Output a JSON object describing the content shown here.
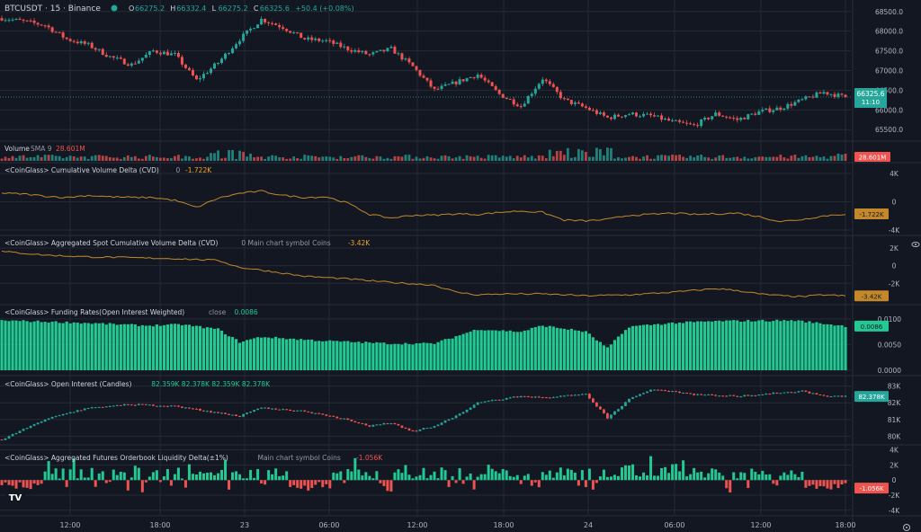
{
  "colors": {
    "bg": "#131722",
    "up": "#26a69a",
    "up_bright": "#22c993",
    "down": "#ef5350",
    "cvd": "#c4882b",
    "grid": "#262a35",
    "axis_text": "#b2b5be",
    "muted": "#9598a1"
  },
  "header": {
    "symbol": "BTCUSDT · 15 · Binance",
    "ohlc": [
      {
        "k": "O",
        "v": "66275.2"
      },
      {
        "k": "H",
        "v": "66332.4"
      },
      {
        "k": "L",
        "v": "66275.2"
      },
      {
        "k": "C",
        "v": "66325.6"
      }
    ],
    "change": "+50.4 (+0.08%)"
  },
  "price_badge": {
    "price": "66325.6",
    "countdown": "11:10"
  },
  "price_axis": [
    "68500.0",
    "68000.0",
    "67500.0",
    "67000.0",
    "66500.0",
    "66000.0",
    "65500.0"
  ],
  "panels": [
    {
      "id": "volume",
      "title": "Volume",
      "params": "SMA 9",
      "value": "28.601M",
      "badge": "28.601M",
      "axis": []
    },
    {
      "id": "cvd",
      "title": "<CoinGlass> Cumulative Volume Delta (CVD)",
      "params": "0",
      "value": "-1.722K",
      "badge": "-1.722K",
      "axis": [
        "4K",
        "0",
        "-4K"
      ]
    },
    {
      "id": "spot_cvd",
      "title": "<CoinGlass> Aggregated Spot Cumulative Volume Delta (CVD)",
      "params": "0 Main chart symbol Coins",
      "value": "-3.42K",
      "badge": "-3.42K",
      "axis": [
        "2K",
        "0",
        "-2K"
      ]
    },
    {
      "id": "funding",
      "title": "<CoinGlass> Funding Rates(Open Interest Weighted)",
      "params": "close",
      "value": "0.0086",
      "badge": "0.0086",
      "axis": [
        "0.0100",
        "0.0050",
        "0.0000"
      ]
    },
    {
      "id": "oi",
      "title": "<CoinGlass> Open Interest (Candles)",
      "params": "",
      "value": "82.359K 82.378K 82.359K 82.378K",
      "badge": "82.378K",
      "axis": [
        "83K",
        "82K",
        "81K",
        "80K"
      ]
    },
    {
      "id": "liq",
      "title": "<CoinGlass> Aggregated Futures Orderbook Liquidity Delta(±1%)",
      "params": "Main chart symbol Coins",
      "value": "-1.056K",
      "badge": "-1.056K",
      "axis": [
        "4K",
        "2K",
        "0",
        "-2K",
        "-4K"
      ]
    }
  ],
  "time_axis": [
    "12:00",
    "18:00",
    "23",
    "06:00",
    "12:00",
    "18:00",
    "24",
    "06:00",
    "12:00",
    "18:00"
  ],
  "logo": "TV",
  "icons": {
    "eye": "eye-icon",
    "settings": "gear-icon"
  },
  "chart_data": [
    {
      "type": "candlestick",
      "title": "BTCUSDT · 15 · Binance",
      "ylim": [
        65300,
        68700
      ],
      "y_ticks": [
        68500,
        68000,
        67500,
        67000,
        66500,
        66000,
        65500
      ],
      "x_ticks": [
        "12:00",
        "18:00",
        "23",
        "06:00",
        "12:00",
        "18:00",
        "24",
        "06:00",
        "12:00",
        "18:00"
      ],
      "close_path": [
        [
          0,
          68330
        ],
        [
          6,
          68250
        ],
        [
          12,
          68150
        ],
        [
          18,
          67800
        ],
        [
          24,
          67650
        ],
        [
          30,
          67350
        ],
        [
          36,
          67150
        ],
        [
          42,
          67500
        ],
        [
          48,
          67400
        ],
        [
          54,
          66750
        ],
        [
          60,
          67200
        ],
        [
          66,
          67800
        ],
        [
          72,
          68300
        ],
        [
          78,
          68100
        ],
        [
          84,
          67800
        ],
        [
          90,
          67750
        ],
        [
          96,
          67550
        ],
        [
          102,
          67400
        ],
        [
          108,
          67550
        ],
        [
          114,
          67100
        ],
        [
          120,
          66500
        ],
        [
          126,
          66700
        ],
        [
          132,
          66900
        ],
        [
          138,
          66400
        ],
        [
          144,
          66100
        ],
        [
          150,
          66800
        ],
        [
          156,
          66250
        ],
        [
          162,
          66050
        ],
        [
          168,
          65800
        ],
        [
          174,
          65900
        ],
        [
          180,
          65850
        ],
        [
          186,
          65700
        ],
        [
          192,
          65600
        ],
        [
          198,
          65900
        ],
        [
          204,
          65750
        ],
        [
          210,
          65950
        ],
        [
          216,
          66050
        ],
        [
          222,
          66250
        ],
        [
          228,
          66450
        ],
        [
          234,
          66326
        ]
      ]
    },
    {
      "type": "bar",
      "name": "Volume",
      "sma": "SMA 9",
      "last": "28.601M"
    },
    {
      "type": "line",
      "name": "<CoinGlass> Cumulative Volume Delta (CVD)",
      "ylim": [
        -4000,
        4000
      ],
      "y_ticks": [
        4000,
        0,
        -4000
      ],
      "last": -1722,
      "points": [
        [
          0,
          1200
        ],
        [
          6,
          1100
        ],
        [
          12,
          800
        ],
        [
          18,
          600
        ],
        [
          24,
          900
        ],
        [
          30,
          700
        ],
        [
          36,
          600
        ],
        [
          42,
          600
        ],
        [
          48,
          200
        ],
        [
          54,
          -800
        ],
        [
          60,
          500
        ],
        [
          66,
          1200
        ],
        [
          72,
          1500
        ],
        [
          78,
          900
        ],
        [
          84,
          600
        ],
        [
          90,
          700
        ],
        [
          96,
          -200
        ],
        [
          102,
          -1800
        ],
        [
          108,
          -2300
        ],
        [
          114,
          -1900
        ],
        [
          120,
          -1900
        ],
        [
          126,
          -1700
        ],
        [
          132,
          -1800
        ],
        [
          138,
          -1500
        ],
        [
          144,
          -1300
        ],
        [
          150,
          -1500
        ],
        [
          156,
          -2600
        ],
        [
          162,
          -2700
        ],
        [
          168,
          -2500
        ],
        [
          174,
          -1900
        ],
        [
          180,
          -1800
        ],
        [
          186,
          -1600
        ],
        [
          192,
          -1800
        ],
        [
          198,
          -1700
        ],
        [
          204,
          -1600
        ],
        [
          210,
          -2100
        ],
        [
          216,
          -2800
        ],
        [
          222,
          -2500
        ],
        [
          228,
          -2000
        ],
        [
          234,
          -1722
        ]
      ]
    },
    {
      "type": "line",
      "name": "<CoinGlass> Aggregated Spot Cumulative Volume Delta (CVD)",
      "ylim": [
        -3800,
        2200
      ],
      "y_ticks": [
        2000,
        0,
        -2000
      ],
      "last": -3420,
      "points": [
        [
          0,
          1600
        ],
        [
          12,
          1200
        ],
        [
          24,
          1000
        ],
        [
          36,
          900
        ],
        [
          48,
          800
        ],
        [
          60,
          600
        ],
        [
          66,
          -200
        ],
        [
          72,
          -500
        ],
        [
          84,
          -1200
        ],
        [
          96,
          -1500
        ],
        [
          108,
          -1900
        ],
        [
          120,
          -2200
        ],
        [
          126,
          -3000
        ],
        [
          132,
          -3300
        ],
        [
          138,
          -3200
        ],
        [
          150,
          -3200
        ],
        [
          162,
          -3400
        ],
        [
          174,
          -3300
        ],
        [
          186,
          -3000
        ],
        [
          198,
          -2600
        ],
        [
          204,
          -2800
        ],
        [
          210,
          -3200
        ],
        [
          216,
          -3400
        ],
        [
          222,
          -3500
        ],
        [
          228,
          -3300
        ],
        [
          234,
          -3420
        ]
      ]
    },
    {
      "type": "bar",
      "name": "<CoinGlass> Funding Rates(Open Interest Weighted)",
      "ylim": [
        0,
        0.0105
      ],
      "y_ticks": [
        0.01,
        0.005,
        0
      ],
      "last": 0.0086,
      "points": [
        [
          0,
          0.0097
        ],
        [
          20,
          0.0093
        ],
        [
          40,
          0.0087
        ],
        [
          50,
          0.0089
        ],
        [
          60,
          0.008
        ],
        [
          66,
          0.0055
        ],
        [
          72,
          0.0065
        ],
        [
          90,
          0.0057
        ],
        [
          108,
          0.0052
        ],
        [
          120,
          0.0052
        ],
        [
          132,
          0.008
        ],
        [
          144,
          0.0075
        ],
        [
          150,
          0.0087
        ],
        [
          162,
          0.0075
        ],
        [
          168,
          0.0043
        ],
        [
          174,
          0.0085
        ],
        [
          186,
          0.0092
        ],
        [
          200,
          0.0096
        ],
        [
          220,
          0.0097
        ],
        [
          234,
          0.0086
        ]
      ]
    },
    {
      "type": "candlestick",
      "name": "<CoinGlass> Open Interest (Candles)",
      "ylim": [
        79700,
        83300
      ],
      "y_ticks": [
        83000,
        82000,
        81000,
        80000
      ],
      "last": 82378,
      "close_path": [
        [
          0,
          79800
        ],
        [
          12,
          81000
        ],
        [
          24,
          81700
        ],
        [
          36,
          81900
        ],
        [
          48,
          81800
        ],
        [
          60,
          81400
        ],
        [
          66,
          81200
        ],
        [
          72,
          81700
        ],
        [
          84,
          81500
        ],
        [
          96,
          81000
        ],
        [
          102,
          80600
        ],
        [
          108,
          80800
        ],
        [
          114,
          80300
        ],
        [
          120,
          80600
        ],
        [
          126,
          81200
        ],
        [
          132,
          82000
        ],
        [
          144,
          82400
        ],
        [
          150,
          82300
        ],
        [
          162,
          82500
        ],
        [
          168,
          81100
        ],
        [
          174,
          82200
        ],
        [
          180,
          82800
        ],
        [
          186,
          82700
        ],
        [
          192,
          82500
        ],
        [
          204,
          82400
        ],
        [
          216,
          82600
        ],
        [
          222,
          82700
        ],
        [
          228,
          82400
        ],
        [
          234,
          82378
        ]
      ]
    },
    {
      "type": "bar",
      "name": "<CoinGlass> Aggregated Futures Orderbook Liquidity Delta(±1%)",
      "ylim": [
        -4500,
        4200
      ],
      "y_ticks": [
        4000,
        2000,
        0,
        -2000,
        -4000
      ],
      "last": -1056
    }
  ]
}
